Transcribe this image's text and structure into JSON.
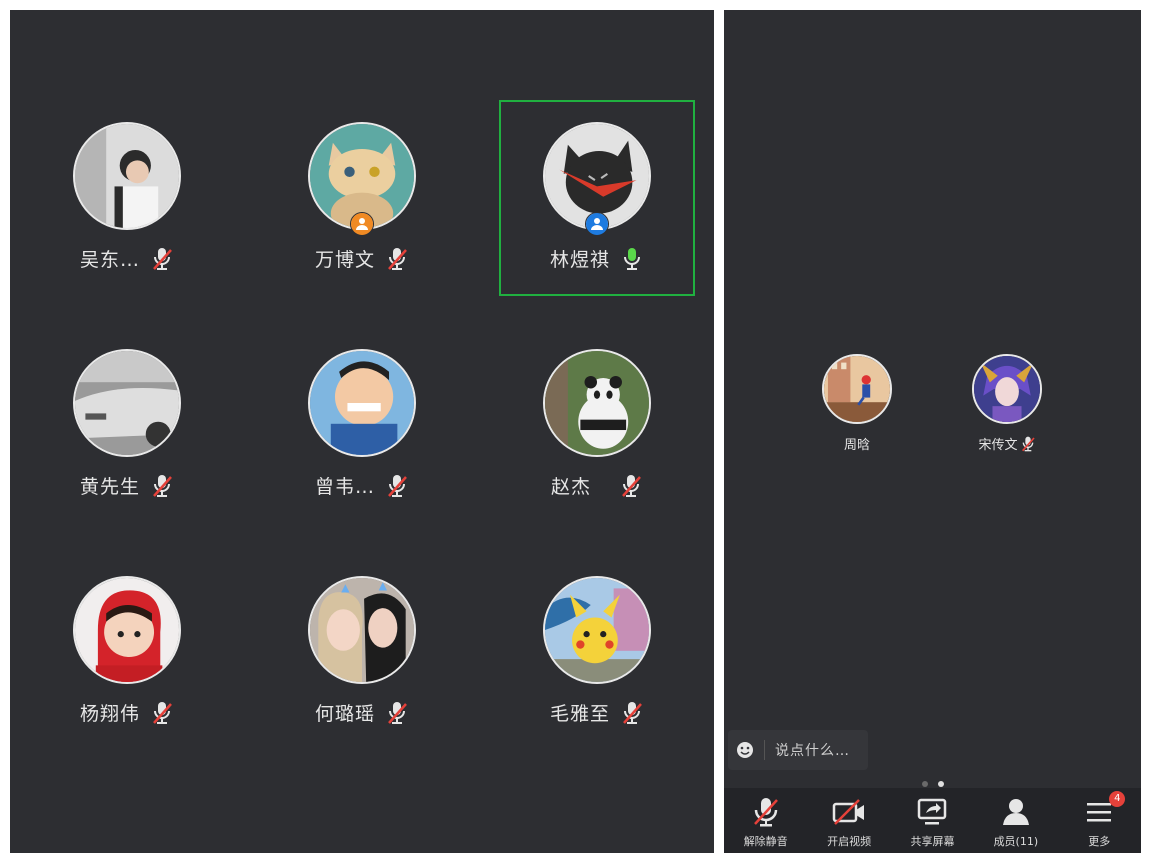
{
  "grid": {
    "participants": [
      {
        "name": "吴东…",
        "muted": true,
        "host": false,
        "active": false,
        "avatar_icon": "man-photo-avatar"
      },
      {
        "name": "万博文",
        "muted": true,
        "host": true,
        "host_color": "#f08a24",
        "active": false,
        "avatar_icon": "cat-cartoon-avatar"
      },
      {
        "name": "林煜祺",
        "muted": false,
        "host": true,
        "host_color": "#1e7be0",
        "active": true,
        "avatar_icon": "black-cat-avatar"
      },
      {
        "name": "黄先生",
        "muted": true,
        "host": false,
        "active": false,
        "avatar_icon": "car-photo-avatar"
      },
      {
        "name": "曾韦…",
        "muted": true,
        "host": false,
        "active": false,
        "avatar_icon": "cartoon-boy-avatar"
      },
      {
        "name": "赵杰",
        "muted": true,
        "host": false,
        "active": false,
        "avatar_icon": "panda-photo-avatar"
      },
      {
        "name": "杨翔伟",
        "muted": true,
        "host": false,
        "active": false,
        "avatar_icon": "child-photo-avatar"
      },
      {
        "name": "何璐瑶",
        "muted": true,
        "host": false,
        "active": false,
        "avatar_icon": "selfie-photo-avatar"
      },
      {
        "name": "毛雅至",
        "muted": true,
        "host": false,
        "active": false,
        "avatar_icon": "pikachu-avatar"
      }
    ]
  },
  "page2": {
    "participants": [
      {
        "name": "周晗",
        "muted": false,
        "avatar_icon": "cartoon-building-avatar"
      },
      {
        "name": "宋传文",
        "muted": true,
        "avatar_icon": "game-character-avatar"
      }
    ]
  },
  "chat": {
    "placeholder": "说点什么…",
    "icon": "smile-icon"
  },
  "pager": {
    "pages": 2,
    "current": 2
  },
  "toolbar": {
    "unmute_label": "解除静音",
    "video_label": "开启视频",
    "share_label": "共享屏幕",
    "members_label": "成员(11)",
    "more_label": "更多",
    "more_badge": "4"
  },
  "colors": {
    "background": "#2d2e32",
    "active_border": "#20b040",
    "mic_active": "#5ad84a",
    "mute_slash": "#e5413a",
    "badge": "#e5413a"
  }
}
